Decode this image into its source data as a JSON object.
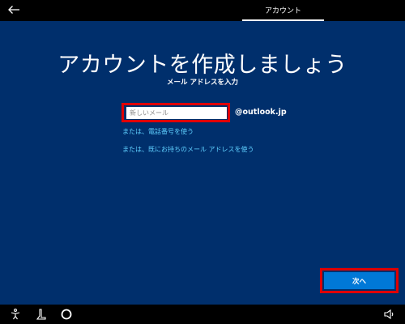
{
  "header": {
    "back_icon": "back-arrow-icon",
    "tab_label": "アカウント"
  },
  "main": {
    "title": "アカウントを作成しましょう",
    "subtitle": "メール アドレスを入力",
    "email_placeholder": "新しいメール",
    "email_value": "",
    "domain_suffix": "@outlook.jp",
    "link_phone": "または、電話番号を使う",
    "link_existing": "または、既にお持ちのメール アドレスを使う",
    "next_label": "次へ"
  },
  "taskbar": {
    "icons": [
      "ease-of-access-icon",
      "narrator-icon",
      "cortana-icon",
      "volume-icon"
    ]
  },
  "colors": {
    "background": "#002f6c",
    "bar": "#000000",
    "accent_button": "#0078d7",
    "link": "#5fd0ff",
    "highlight": "#e00000"
  }
}
